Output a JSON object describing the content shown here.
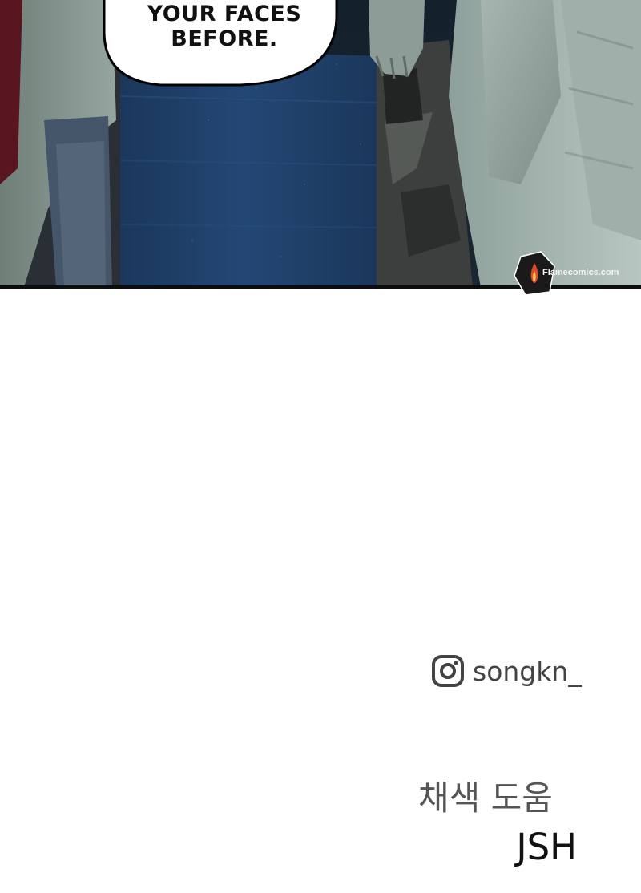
{
  "panel": {
    "speech_bubble_text": "YOUR FACES\nBEFORE.",
    "speech_line_1": "YOUR FACES",
    "speech_line_2": "BEFORE.",
    "watermark_text": "Flamecomics.com",
    "colors": {
      "background_dark": "#1a2430",
      "blue_tarp": "#1f3d63",
      "bubble_fill": "#ffffff",
      "border": "#0d0d0d"
    }
  },
  "credits": {
    "instagram_handle": "songkn_",
    "role_label": "채색 도움",
    "role_name": "JSH",
    "icon": "instagram-icon"
  }
}
